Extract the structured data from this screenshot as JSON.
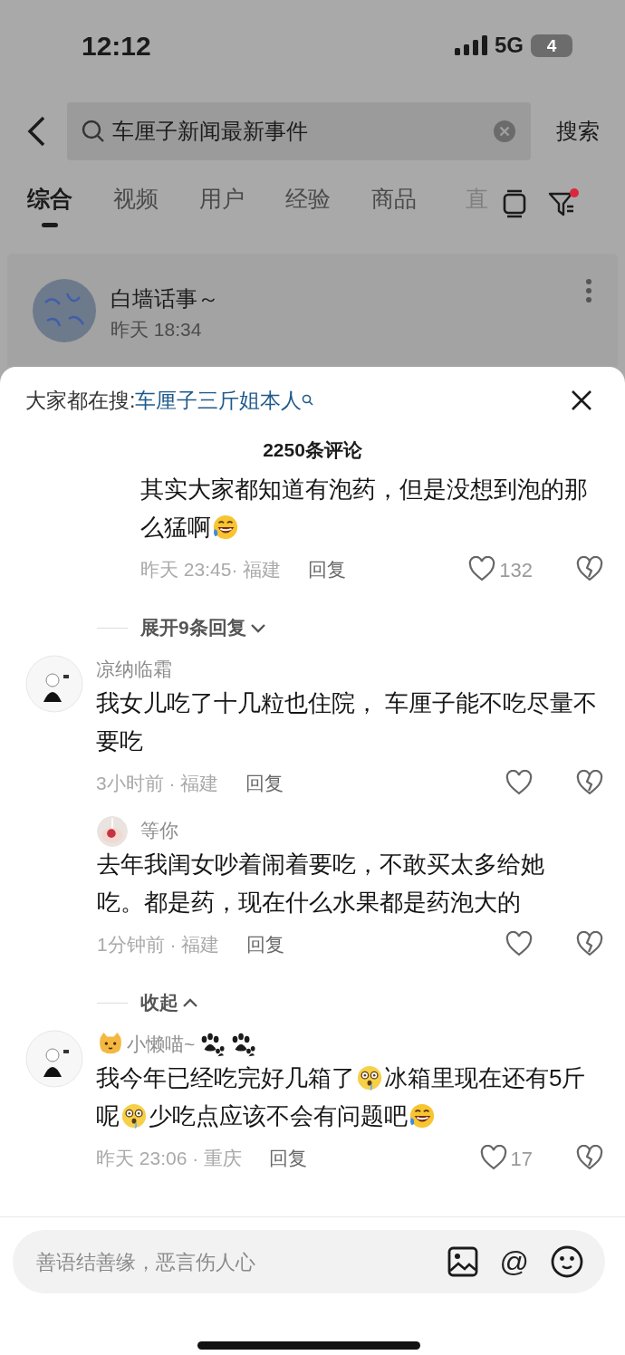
{
  "status_bar": {
    "time": "12:12",
    "network": "5G",
    "battery": "4"
  },
  "search": {
    "query": "车厘子新闻最新事件",
    "button": "搜索"
  },
  "tabs": [
    {
      "label": "综合",
      "selected": true
    },
    {
      "label": "视频",
      "selected": false
    },
    {
      "label": "用户",
      "selected": false
    },
    {
      "label": "经验",
      "selected": false
    },
    {
      "label": "商品",
      "selected": false
    },
    {
      "label": "直",
      "selected": false
    }
  ],
  "filter": {
    "notification_dot": true
  },
  "post": {
    "author": "白墙话事～",
    "time": "昨天 18:34"
  },
  "sheet": {
    "trending_label": "大家都在搜:",
    "trending_query": "车厘子三斤姐本人",
    "title": "2250条评论"
  },
  "comments": [
    {
      "kind": "reply",
      "body": [
        [
          {
            "kind": "text",
            "text": "其实大家都知道有泡药，但是没想到泡的那"
          }
        ],
        [
          {
            "kind": "text",
            "text": "么猛啊"
          },
          {
            "kind": "laugh-cry"
          }
        ]
      ],
      "meta": "昨天 23:45· 福建",
      "reply": "回复",
      "likes": "132"
    },
    {
      "kind": "toggle",
      "label": "展开9条回复",
      "expanded": false
    },
    {
      "kind": "comment",
      "user": [
        {
          "kind": "text",
          "text": "凉纳临霜"
        }
      ],
      "body": [
        [
          {
            "kind": "text",
            "text": "我女儿吃了十几粒也住院， 车厘子能不吃尽量不"
          }
        ],
        [
          {
            "kind": "text",
            "text": "要吃"
          }
        ]
      ],
      "meta": "3小时前 · 福建",
      "reply": "回复"
    },
    {
      "kind": "reply",
      "user": [
        {
          "kind": "text",
          "text": "等你"
        }
      ],
      "body": [
        [
          {
            "kind": "text",
            "text": "去年我闺女吵着闹着要吃，不敢买太多给她"
          }
        ],
        [
          {
            "kind": "text",
            "text": "吃。都是药，现在什么水果都是药泡大的"
          }
        ]
      ],
      "meta": "1分钟前 · 福建",
      "reply": "回复"
    },
    {
      "kind": "toggle",
      "label": "收起",
      "expanded": true
    },
    {
      "kind": "comment",
      "user": [
        {
          "kind": "cat"
        },
        {
          "kind": "text",
          "text": "小懒喵~"
        },
        {
          "kind": "paw"
        },
        {
          "kind": "paw"
        }
      ],
      "body": [
        [
          {
            "kind": "text",
            "text": "我今年已经吃完好几箱了"
          },
          {
            "kind": "stunned"
          },
          {
            "kind": "text",
            "text": "冰箱里现在还有5斤"
          }
        ],
        [
          {
            "kind": "text",
            "text": "呢"
          },
          {
            "kind": "stunned"
          },
          {
            "kind": "text",
            "text": "少吃点应该不会有问题吧"
          },
          {
            "kind": "laugh-cry"
          }
        ]
      ],
      "meta": "昨天 23:06 · 重庆",
      "reply": "回复",
      "likes": "17"
    }
  ],
  "composer": {
    "placeholder": "善语结善缘，恶言伤人心",
    "mention": "@"
  }
}
